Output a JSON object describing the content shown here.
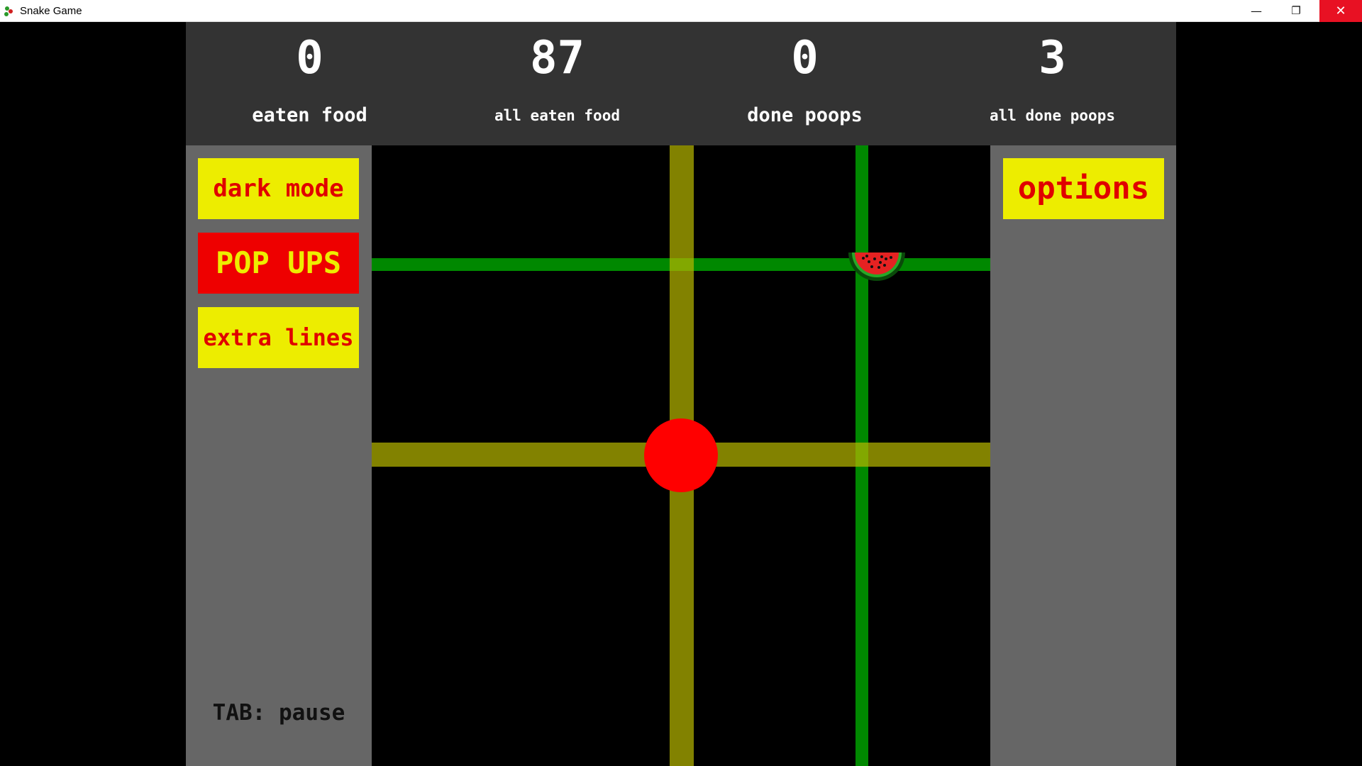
{
  "window": {
    "title": "Snake Game",
    "controls": {
      "minimize": "—",
      "maximize": "❐",
      "close": "✕"
    }
  },
  "scoreboard": [
    {
      "value": "0",
      "label": "eaten food"
    },
    {
      "value": "87",
      "label": "all eaten food"
    },
    {
      "value": "0",
      "label": "done poops"
    },
    {
      "value": "3",
      "label": "all done poops"
    }
  ],
  "left_panel": {
    "buttons": {
      "dark_mode": "dark mode",
      "pop_ups": "POP UPS",
      "extra_lines": "extra lines"
    },
    "hint": "TAB: pause"
  },
  "right_panel": {
    "options": "options"
  },
  "colors": {
    "score_bg": "#333333",
    "panel_bg": "#666666",
    "button_yellow": "#eded00",
    "button_red": "#ee0000",
    "snake": "#ff0000",
    "food_line": "#008800",
    "snake_line": "#b4b400"
  },
  "board": {
    "food_icon": "watermelon-icon",
    "snake": "snake-head"
  }
}
